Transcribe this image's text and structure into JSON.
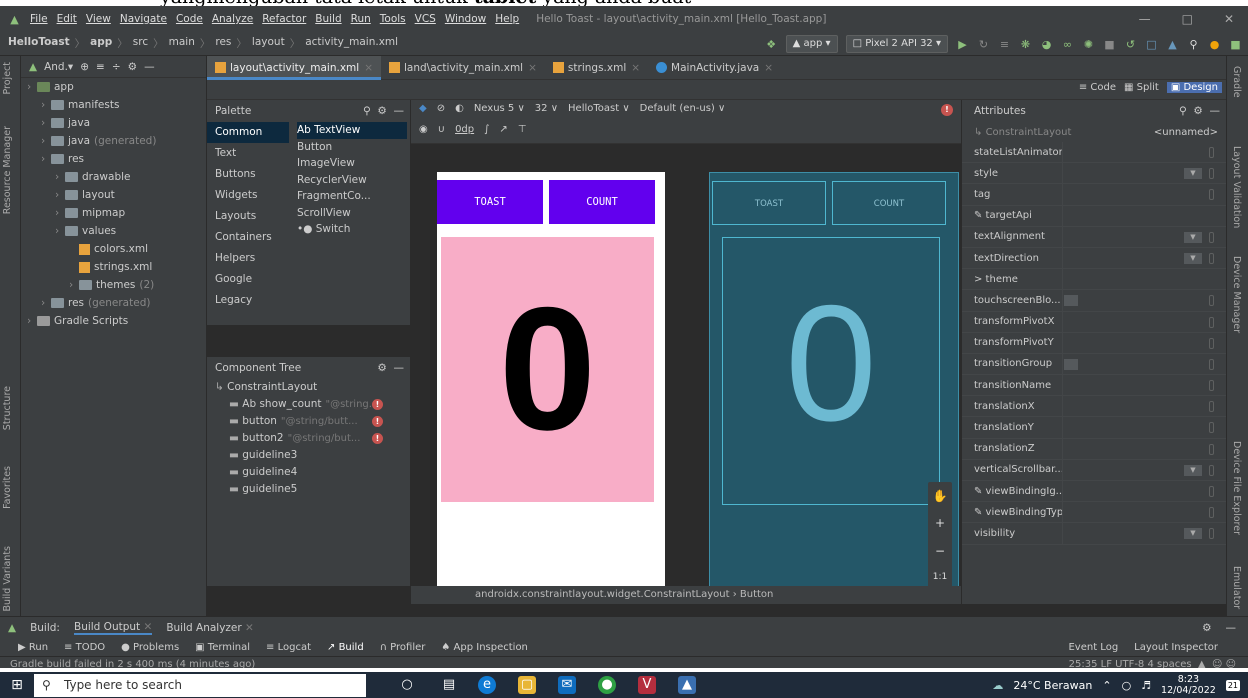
{
  "doc_text_prefix": "yangmengubah tata letak untuk ",
  "doc_text_bold": "tablet",
  "doc_text_suffix": " yang anda buat",
  "menu": [
    "File",
    "Edit",
    "View",
    "Navigate",
    "Code",
    "Analyze",
    "Refactor",
    "Build",
    "Run",
    "Tools",
    "VCS",
    "Window",
    "Help"
  ],
  "window_title": "Hello Toast - layout\\activity_main.xml [Hello_Toast.app]",
  "breadcrumb": [
    "HelloToast",
    "app",
    "src",
    "main",
    "res",
    "layout",
    "activity_main.xml"
  ],
  "run_config": "app",
  "device": "Pixel 2 API 32",
  "project_view": "And.▾",
  "project_tree": [
    {
      "label": "app",
      "indent": 0,
      "kind": "module"
    },
    {
      "label": "manifests",
      "indent": 1,
      "kind": "folder"
    },
    {
      "label": "java",
      "indent": 1,
      "kind": "folder"
    },
    {
      "label": "java",
      "suffix": "(generated)",
      "indent": 1,
      "kind": "folder"
    },
    {
      "label": "res",
      "indent": 1,
      "kind": "folder"
    },
    {
      "label": "drawable",
      "indent": 2,
      "kind": "folder"
    },
    {
      "label": "layout",
      "indent": 2,
      "kind": "folder"
    },
    {
      "label": "mipmap",
      "indent": 2,
      "kind": "folder"
    },
    {
      "label": "values",
      "indent": 2,
      "kind": "folder"
    },
    {
      "label": "colors.xml",
      "indent": 3,
      "kind": "xml"
    },
    {
      "label": "strings.xml",
      "indent": 3,
      "kind": "xml"
    },
    {
      "label": "themes",
      "suffix": "(2)",
      "indent": 3,
      "kind": "folder"
    },
    {
      "label": "res",
      "suffix": "(generated)",
      "indent": 1,
      "kind": "folder"
    },
    {
      "label": "Gradle Scripts",
      "indent": 0,
      "kind": "gradle"
    }
  ],
  "tabs": [
    "layout\\activity_main.xml",
    "land\\activity_main.xml",
    "strings.xml",
    "MainActivity.java"
  ],
  "modes": [
    "Code",
    "Split",
    "Design"
  ],
  "palette_title": "Palette",
  "palette_categories": [
    "Common",
    "Text",
    "Buttons",
    "Widgets",
    "Layouts",
    "Containers",
    "Helpers",
    "Google",
    "Legacy"
  ],
  "palette_items": [
    "Ab TextView",
    "Button",
    "ImageView",
    "RecyclerView",
    "FragmentCo...",
    "ScrollView",
    "•● Switch"
  ],
  "surface_row1": [
    "Nexus 5 ∨",
    "32 ∨",
    "HelloToast ∨",
    "Default (en-us) ∨"
  ],
  "surface_row2": [
    "0dp"
  ],
  "component_tree_title": "Component Tree",
  "component_tree": [
    {
      "label": "ConstraintLayout",
      "ref": "",
      "error": false,
      "indent": 0
    },
    {
      "label": "Ab show_count",
      "ref": "\"@string...",
      "error": true,
      "indent": 1
    },
    {
      "label": "button",
      "ref": "\"@string/butt...",
      "error": true,
      "indent": 1
    },
    {
      "label": "button2",
      "ref": "\"@string/but...",
      "error": true,
      "indent": 1
    },
    {
      "label": "guideline3",
      "ref": "",
      "error": false,
      "indent": 1
    },
    {
      "label": "guideline4",
      "ref": "",
      "error": false,
      "indent": 1
    },
    {
      "label": "guideline5",
      "ref": "",
      "error": false,
      "indent": 1
    }
  ],
  "preview": {
    "toast": "TOAST",
    "count": "COUNT",
    "number": "0"
  },
  "blueprint": {
    "toast": "TOAST",
    "count": "COUNT",
    "number": "0"
  },
  "zoom_controls": [
    "+",
    "−",
    "1:1"
  ],
  "layout_breadcrumb": "androidx.constraintlayout.widget.ConstraintLayout  ›  Button",
  "attributes_title": "Attributes",
  "attr_component": "ConstraintLayout",
  "attr_id": "<unnamed>",
  "attributes": [
    {
      "name": "stateListAnimator",
      "kind": "dot"
    },
    {
      "name": "style",
      "kind": "dd"
    },
    {
      "name": "tag",
      "kind": "dot"
    },
    {
      "name": "✎ targetApi",
      "kind": "none"
    },
    {
      "name": "textAlignment",
      "kind": "dd"
    },
    {
      "name": "textDirection",
      "kind": "dd"
    },
    {
      "name": "> theme",
      "kind": "none"
    },
    {
      "name": "touchscreenBlo...",
      "kind": "box"
    },
    {
      "name": "transformPivotX",
      "kind": "dot"
    },
    {
      "name": "transformPivotY",
      "kind": "dot"
    },
    {
      "name": "transitionGroup",
      "kind": "box"
    },
    {
      "name": "transitionName",
      "kind": "dot"
    },
    {
      "name": "translationX",
      "kind": "dot"
    },
    {
      "name": "translationY",
      "kind": "dot"
    },
    {
      "name": "translationZ",
      "kind": "dot"
    },
    {
      "name": "verticalScrollbar...",
      "kind": "dd"
    },
    {
      "name": "✎ viewBindingIg...",
      "kind": "dot"
    },
    {
      "name": "✎ viewBindingType",
      "kind": "dot"
    },
    {
      "name": "visibility",
      "kind": "dd"
    }
  ],
  "left_tool_tabs": [
    "Project",
    "Resource Manager",
    "Structure",
    "Favorites",
    "Build Variants"
  ],
  "right_tool_tabs": [
    "Gradle",
    "Layout Validation",
    "Device Manager",
    "Device File Explorer",
    "Emulator"
  ],
  "build_tabs": [
    "Build:",
    "Build Output",
    "Build Analyzer"
  ],
  "bottom_tools": [
    "▶ Run",
    "≡ TODO",
    "● Problems",
    "▣ Terminal",
    "≡ Logcat",
    "↗ Build",
    "∩ Profiler",
    "♠ App Inspection"
  ],
  "bottom_right_tools": [
    "Event Log",
    "Layout Inspector"
  ],
  "status_msg": "Gradle build failed in 2 s 400 ms (4 minutes ago)",
  "status_right": "25:35  LF  UTF-8  4 spaces",
  "taskbar": {
    "search": "Type here to search",
    "weather": "24°C  Berawan",
    "time": "8:23",
    "date": "12/04/2022",
    "notif": "21"
  }
}
